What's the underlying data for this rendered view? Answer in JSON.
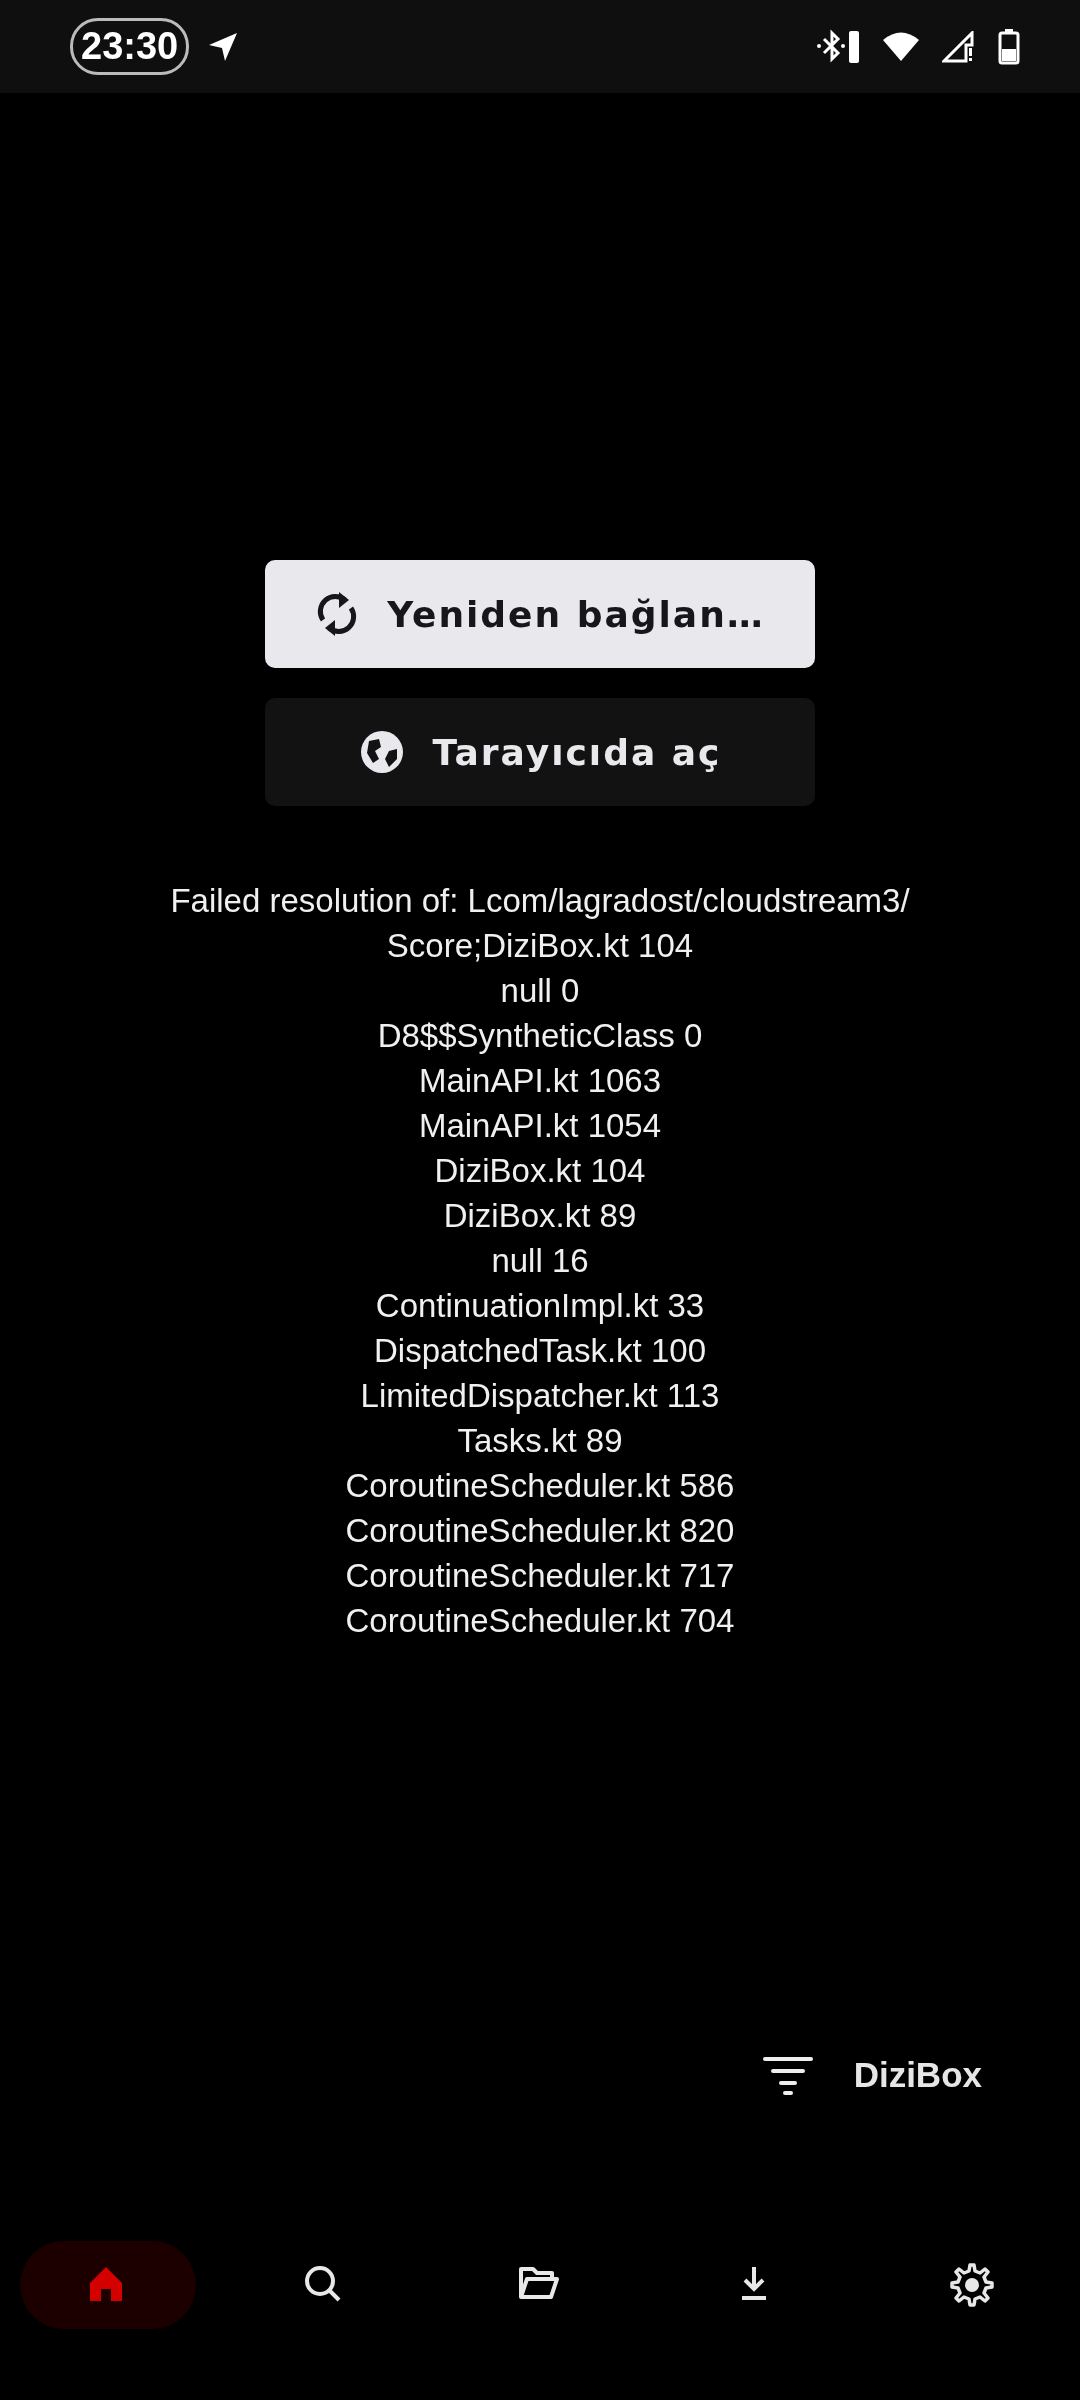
{
  "status_bar": {
    "time": "23:30"
  },
  "buttons": [
    {
      "kind": "reload",
      "label": "Yeniden bağlan…",
      "primary": true
    },
    {
      "kind": "browser",
      "label": "Tarayıcıda aç",
      "primary": false
    }
  ],
  "error_lines": [
    "Failed resolution of: Lcom/lagradost/cloudstream3/",
    "Score;DiziBox.kt 104",
    "null 0",
    "D8$$SyntheticClass 0",
    "MainAPI.kt 1063",
    "MainAPI.kt 1054",
    "DiziBox.kt 104",
    "DiziBox.kt 89",
    "null 16",
    "ContinuationImpl.kt 33",
    "DispatchedTask.kt 100",
    "LimitedDispatcher.kt 113",
    "Tasks.kt 89",
    "CoroutineScheduler.kt 586",
    "CoroutineScheduler.kt 820",
    "CoroutineScheduler.kt 717",
    "CoroutineScheduler.kt 704"
  ],
  "provider": {
    "name": "DiziBox"
  },
  "nav": [
    {
      "kind": "home",
      "selected": true
    },
    {
      "kind": "search",
      "selected": false
    },
    {
      "kind": "library",
      "selected": false
    },
    {
      "kind": "downloads",
      "selected": false
    },
    {
      "kind": "settings",
      "selected": false
    }
  ]
}
